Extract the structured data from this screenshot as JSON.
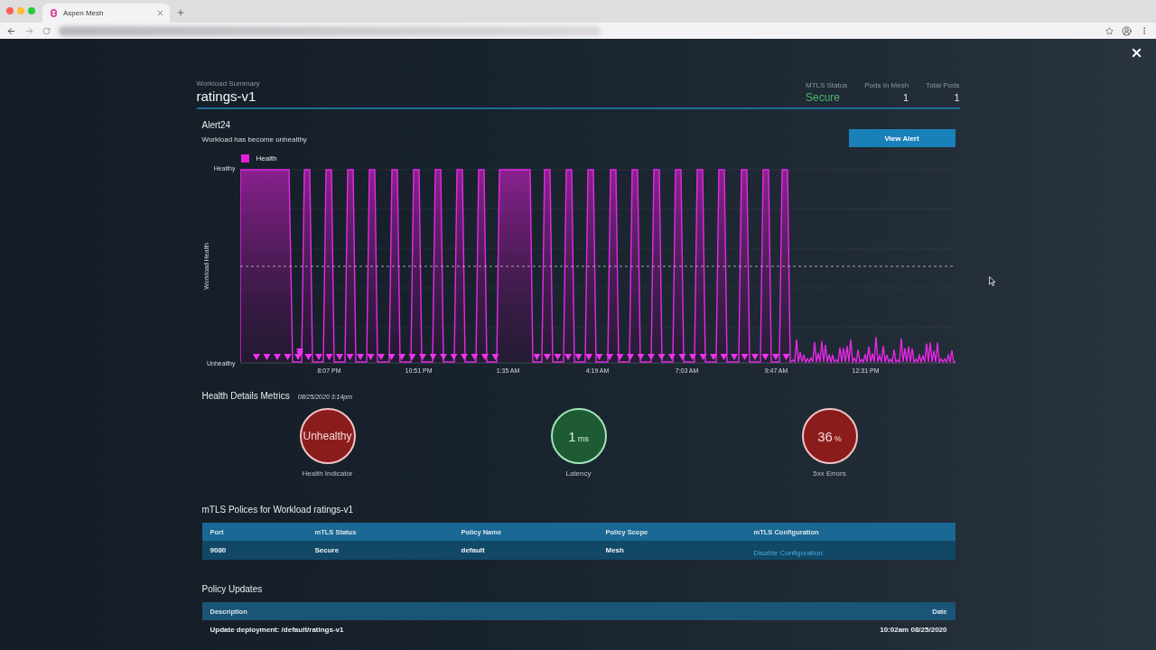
{
  "browser": {
    "tab": {
      "title": "Aspen Mesh"
    }
  },
  "summary": {
    "label": "Workload Summary",
    "name": "ratings-v1",
    "stats": [
      {
        "label": "MTLS Status",
        "value": "Secure",
        "kind": "status"
      },
      {
        "label": "Pods In Mesh",
        "value": "1",
        "kind": "count"
      },
      {
        "label": "Total Pods",
        "value": "1",
        "kind": "count"
      }
    ]
  },
  "alert": {
    "title": "Alert24",
    "message": "Workload has become unhealthy",
    "button": "View Alert"
  },
  "health_chart": {
    "legend": "Health",
    "ylabel": "Workload Health",
    "y_labels": [
      "Healthy",
      "Unhealthy"
    ],
    "x_labels": [
      "8:07 PM",
      "10:51 PM",
      "1:35 AM",
      "4:19 AM",
      "7:03 AM",
      "9:47 AM",
      "12:31 PM"
    ]
  },
  "metrics": {
    "title": "Health Details Metrics",
    "timestamp": "08/25/2020 3:14pm",
    "items": [
      {
        "value": "Unhealthy",
        "label": "Health Indicator",
        "healthy": false
      },
      {
        "value": "1",
        "unit": "ms",
        "label": "Latency",
        "healthy": true
      },
      {
        "value": "36",
        "unit": "%",
        "label": "5xx Errors",
        "healthy": false
      }
    ]
  },
  "mtls_policies": {
    "title": "mTLS Polices for Workload ratings-v1",
    "columns": [
      "Port",
      "mTLS Status",
      "Policy Name",
      "Policy Scope",
      "mTLS Configuration"
    ],
    "rows": [
      {
        "port": "9080",
        "status": "Secure",
        "policy_name": "default",
        "policy_scope": "Mesh",
        "configuration_link": "Disable Configuration"
      }
    ]
  },
  "policy_updates": {
    "title": "Policy Updates",
    "columns": [
      "Description",
      "Date"
    ],
    "rows": [
      {
        "description": "Update deployment: /default/ratings-v1",
        "date": "10:02am 08/25/2020"
      }
    ]
  }
}
